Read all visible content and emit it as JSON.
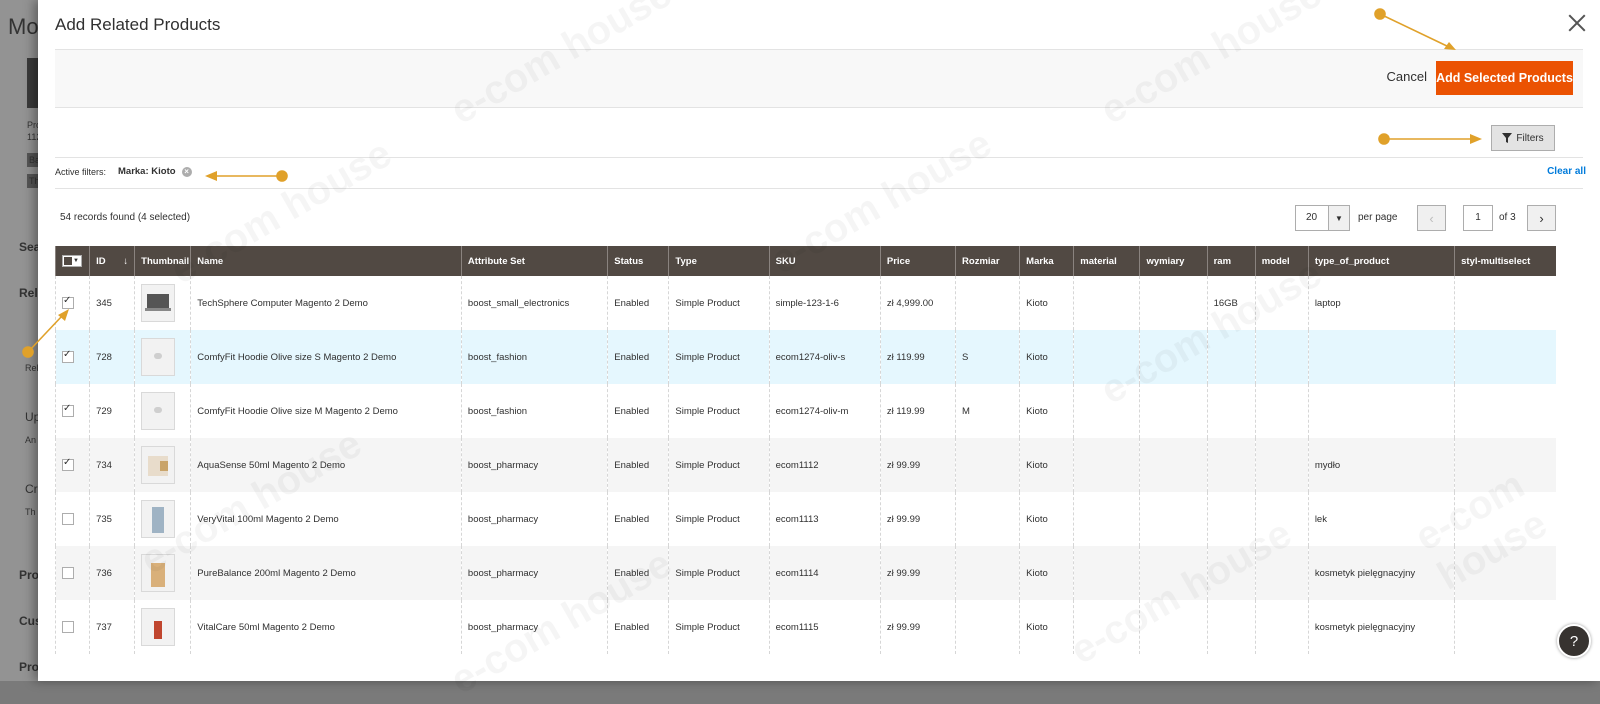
{
  "background": {
    "title_fragment": "Mo",
    "items": [
      "Pro",
      "112",
      "Ba",
      "Th",
      "Sea",
      "Rela",
      "Rel",
      "Up",
      "An",
      "Cr",
      "Th",
      "Pro",
      "Cus",
      "Pro"
    ]
  },
  "modal": {
    "title": "Add Related Products",
    "cancel_label": "Cancel",
    "add_label": "Add Selected Products",
    "filters_label": "Filters"
  },
  "active_filters": {
    "label": "Active filters:",
    "chip": "Marka: Kioto",
    "clear_all": "Clear all"
  },
  "toolbar": {
    "records": "54 records found (4 selected)",
    "per_page_value": "20",
    "per_page_label": "per page",
    "current_page": "1",
    "of_pages": "of 3"
  },
  "columns": [
    "ID",
    "Thumbnail",
    "Name",
    "Attribute Set",
    "Status",
    "Type",
    "SKU",
    "Price",
    "Rozmiar",
    "Marka",
    "material",
    "wymiary",
    "ram",
    "model",
    "type_of_product",
    "styl-multiselect"
  ],
  "rows": [
    {
      "checked": true,
      "id": "345",
      "thumb": "laptop",
      "name": "TechSphere Computer Magento 2 Demo",
      "attribute_set": "boost_small_electronics",
      "status": "Enabled",
      "type": "Simple Product",
      "sku": "simple-123-1-6",
      "price": "zł 4,999.00",
      "rozmiar": "",
      "marka": "Kioto",
      "material": "",
      "wymiary": "",
      "ram": "16GB",
      "model": "",
      "type_of_product": "laptop",
      "styl": ""
    },
    {
      "checked": true,
      "id": "728",
      "thumb": "hoodie",
      "name": "ComfyFit Hoodie Olive size S Magento 2 Demo",
      "attribute_set": "boost_fashion",
      "status": "Enabled",
      "type": "Simple Product",
      "sku": "ecom1274-oliv-s",
      "price": "zł 119.99",
      "rozmiar": "S",
      "marka": "Kioto",
      "material": "",
      "wymiary": "",
      "ram": "",
      "model": "",
      "type_of_product": "",
      "styl": ""
    },
    {
      "checked": true,
      "id": "729",
      "thumb": "hoodie",
      "name": "ComfyFit Hoodie Olive size M Magento 2 Demo",
      "attribute_set": "boost_fashion",
      "status": "Enabled",
      "type": "Simple Product",
      "sku": "ecom1274-oliv-m",
      "price": "zł 119.99",
      "rozmiar": "M",
      "marka": "Kioto",
      "material": "",
      "wymiary": "",
      "ram": "",
      "model": "",
      "type_of_product": "",
      "styl": ""
    },
    {
      "checked": true,
      "id": "734",
      "thumb": "soap",
      "name": "AquaSense 50ml Magento 2 Demo",
      "attribute_set": "boost_pharmacy",
      "status": "Enabled",
      "type": "Simple Product",
      "sku": "ecom1112",
      "price": "zł 99.99",
      "rozmiar": "",
      "marka": "Kioto",
      "material": "",
      "wymiary": "",
      "ram": "",
      "model": "",
      "type_of_product": "mydło",
      "styl": ""
    },
    {
      "checked": false,
      "id": "735",
      "thumb": "bottle",
      "name": "VeryVital 100ml Magento 2 Demo",
      "attribute_set": "boost_pharmacy",
      "status": "Enabled",
      "type": "Simple Product",
      "sku": "ecom1113",
      "price": "zł 99.99",
      "rozmiar": "",
      "marka": "Kioto",
      "material": "",
      "wymiary": "",
      "ram": "",
      "model": "",
      "type_of_product": "lek",
      "styl": ""
    },
    {
      "checked": false,
      "id": "736",
      "thumb": "pump",
      "name": "PureBalance 200ml Magento 2 Demo",
      "attribute_set": "boost_pharmacy",
      "status": "Enabled",
      "type": "Simple Product",
      "sku": "ecom1114",
      "price": "zł 99.99",
      "rozmiar": "",
      "marka": "Kioto",
      "material": "",
      "wymiary": "",
      "ram": "",
      "model": "",
      "type_of_product": "kosmetyk pielęgnacyjny",
      "styl": ""
    },
    {
      "checked": false,
      "id": "737",
      "thumb": "vial",
      "name": "VitalCare 50ml Magento 2 Demo",
      "attribute_set": "boost_pharmacy",
      "status": "Enabled",
      "type": "Simple Product",
      "sku": "ecom1115",
      "price": "zł 99.99",
      "rozmiar": "",
      "marka": "Kioto",
      "material": "",
      "wymiary": "",
      "ram": "",
      "model": "",
      "type_of_product": "kosmetyk pielęgnacyjny",
      "styl": ""
    }
  ],
  "colors": {
    "accent": "#eb5202",
    "header_bg": "#514943",
    "link": "#007bdb",
    "annotation": "#e0a12a",
    "row_highlight": "#e5f7fe"
  },
  "watermark": "e-com house"
}
